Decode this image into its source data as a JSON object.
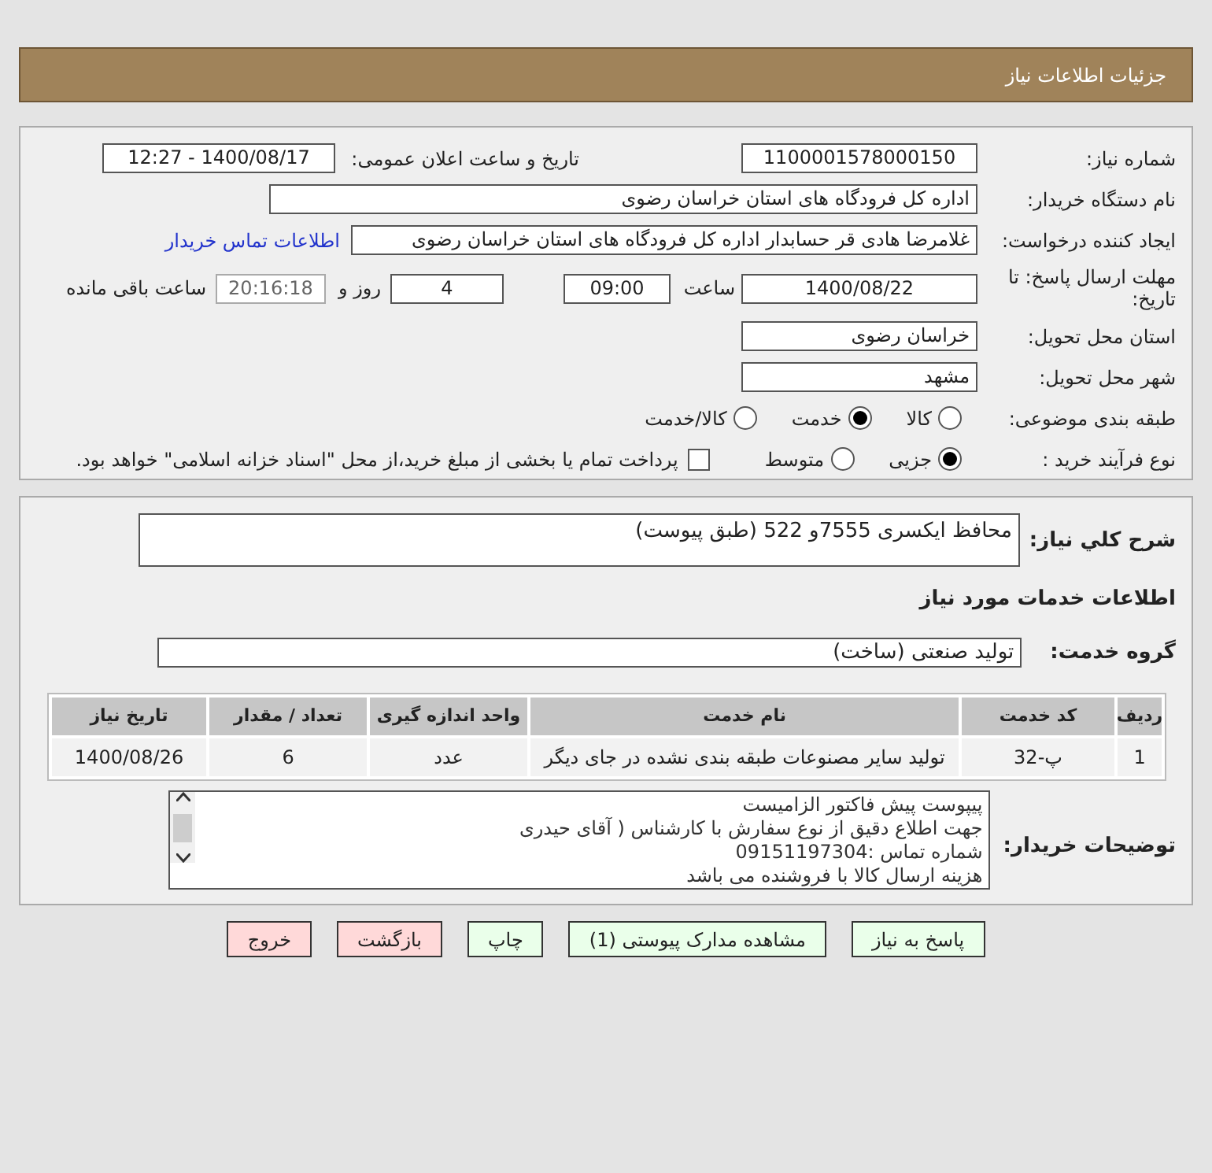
{
  "header": {
    "title": "جزئیات اطلاعات نیاز"
  },
  "need_number": {
    "label": "شماره نیاز:",
    "value": "1100001578000150"
  },
  "announce": {
    "label": "تاریخ و ساعت اعلان عمومی:",
    "value": "1400/08/17 - 12:27"
  },
  "buyer_org": {
    "label": "نام دستگاه خریدار:",
    "value": "اداره کل فرودگاه های استان خراسان رضوی"
  },
  "requester": {
    "label": "ایجاد کننده درخواست:",
    "value": "غلامرضا هادی قر حسابدار اداره کل فرودگاه های استان خراسان رضوی",
    "link": "اطلاعات تماس خریدار"
  },
  "deadline": {
    "label": "مهلت ارسال پاسخ: تا تاریخ:",
    "date": "1400/08/22",
    "time_label": "ساعت",
    "time": "09:00",
    "days": "4",
    "days_label": "روز و",
    "remaining": "20:16:18",
    "remaining_label": "ساعت باقی مانده"
  },
  "province": {
    "label": "استان محل تحویل:",
    "value": "خراسان رضوی"
  },
  "city": {
    "label": "شهر محل تحویل:",
    "value": "مشهد"
  },
  "category": {
    "label": "طبقه بندی موضوعی:",
    "options": [
      {
        "label": "کالا",
        "selected": false
      },
      {
        "label": "خدمت",
        "selected": true
      },
      {
        "label": "کالا/خدمت",
        "selected": false
      }
    ]
  },
  "purchase_type": {
    "label": "نوع فرآیند خرید :",
    "options": [
      {
        "label": "جزیی",
        "selected": true
      },
      {
        "label": "متوسط",
        "selected": false
      }
    ],
    "treasury": {
      "checked": false,
      "text": "پرداخت تمام یا بخشی از مبلغ خرید،از محل \"اسناد خزانه اسلامی\" خواهد بود."
    }
  },
  "summary": {
    "label": "شرح کلي نیاز:",
    "value": "محافظ ایکسری 7555و 522 (طبق پیوست)"
  },
  "services_heading": "اطلاعات خدمات مورد نیاز",
  "service_group": {
    "label": "گروه خدمت:",
    "value": "تولید صنعتی (ساخت)"
  },
  "table": {
    "columns": [
      "ردیف",
      "کد خدمت",
      "نام خدمت",
      "واحد اندازه گیری",
      "تعداد / مقدار",
      "تاریخ نیاز"
    ],
    "rows": [
      [
        "1",
        "پ-32",
        "تولید سایر مصنوعات طبقه بندی نشده در جای دیگر",
        "عدد",
        "6",
        "1400/08/26"
      ]
    ]
  },
  "buyer_notes": {
    "label": "توضیحات خریدار:",
    "lines": [
      "پیپوست پیش فاکتور الزامیست",
      "جهت اطلاع دقیق از نوع سفارش با کارشناس  ( آقای حیدری",
      "شماره تماس :09151197304",
      "هزینه ارسال کالا با فروشنده می باشد"
    ]
  },
  "buttons": [
    {
      "label": "پاسخ به نیاز",
      "kind": "primary"
    },
    {
      "label": "مشاهده مدارک پیوستی (1)",
      "kind": "primary"
    },
    {
      "label": "چاپ",
      "kind": "primary"
    },
    {
      "label": "بازگشت",
      "kind": "danger"
    },
    {
      "label": "خروج",
      "kind": "danger"
    }
  ]
}
